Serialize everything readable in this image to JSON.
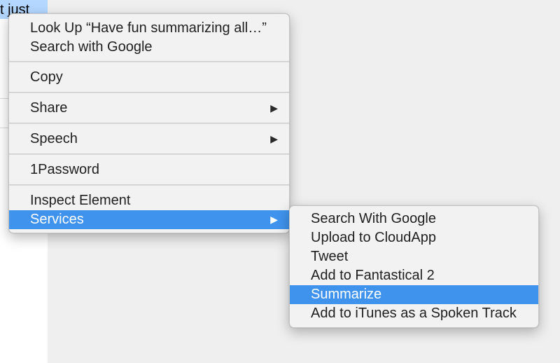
{
  "document": {
    "selected_text_fragment": "t just"
  },
  "context_menu": {
    "look_up": "Look Up “Have fun summarizing all…”",
    "search_google": "Search with Google",
    "copy": "Copy",
    "share": "Share",
    "speech": "Speech",
    "onepassword": "1Password",
    "inspect_element": "Inspect Element",
    "services": "Services",
    "submenu_arrow": "▶"
  },
  "services_menu": {
    "items": [
      "Search With Google",
      "Upload to CloudApp",
      "Tweet",
      "Add to Fantastical 2",
      "Summarize",
      "Add to iTunes as a Spoken Track"
    ],
    "highlighted": "Summarize"
  },
  "colors": {
    "highlight": "#3f93ed",
    "selection": "#b3d7ff"
  }
}
